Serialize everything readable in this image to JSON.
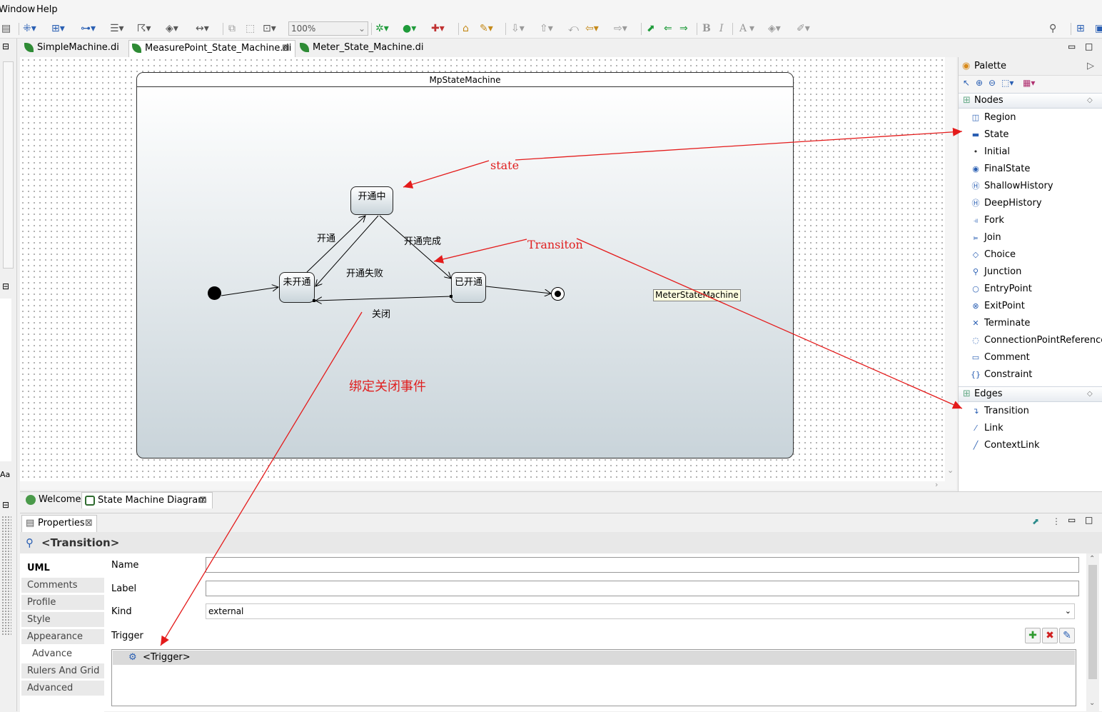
{
  "menu": {
    "items": [
      "Window",
      "Help"
    ]
  },
  "toolbar": {
    "zoom_value": "100%",
    "font_glyphs": [
      "B",
      "I",
      "A"
    ]
  },
  "editor_tabs": [
    "SimpleMachine.di",
    "MeasurePoint_State_Machine.di",
    "Meter_State_Machine.di"
  ],
  "diagram": {
    "machine_title": "MpStateMachine",
    "states": [
      "开通中",
      "未开通",
      "已开通"
    ],
    "transitions": [
      "开通",
      "开通完成",
      "开通失败",
      "关闭"
    ],
    "tooltip": "MeterStateMachine"
  },
  "annotations": {
    "state": "state",
    "transition": "Transiton",
    "bind": "绑定关闭事件"
  },
  "left_strip": {
    "label": "Aa"
  },
  "palette": {
    "title": "Palette",
    "nodes_drawer": "Nodes",
    "nodes": [
      "Region",
      "State",
      "Initial",
      "FinalState",
      "ShallowHistory",
      "DeepHistory",
      "Fork",
      "Join",
      "Choice",
      "Junction",
      "EntryPoint",
      "ExitPoint",
      "Terminate",
      "ConnectionPointReference",
      "Comment",
      "Constraint"
    ],
    "edges_drawer": "Edges",
    "edges": [
      "Transition",
      "Link",
      "ContextLink"
    ]
  },
  "view_tabs": [
    "Welcome",
    "State Machine Diagram"
  ],
  "properties": {
    "tab_label": "Properties",
    "title": "<Transition>",
    "tabs": [
      "UML",
      "Comments",
      "Profile",
      "Style",
      "Appearance",
      "Advance",
      "Rulers And Grid",
      "Advanced"
    ],
    "fields": {
      "name_label": "Name",
      "name_value": "",
      "label_label": "Label",
      "label_value": "",
      "kind_label": "Kind",
      "kind_value": "external",
      "trigger_label": "Trigger"
    },
    "trigger_item": "<Trigger>"
  }
}
